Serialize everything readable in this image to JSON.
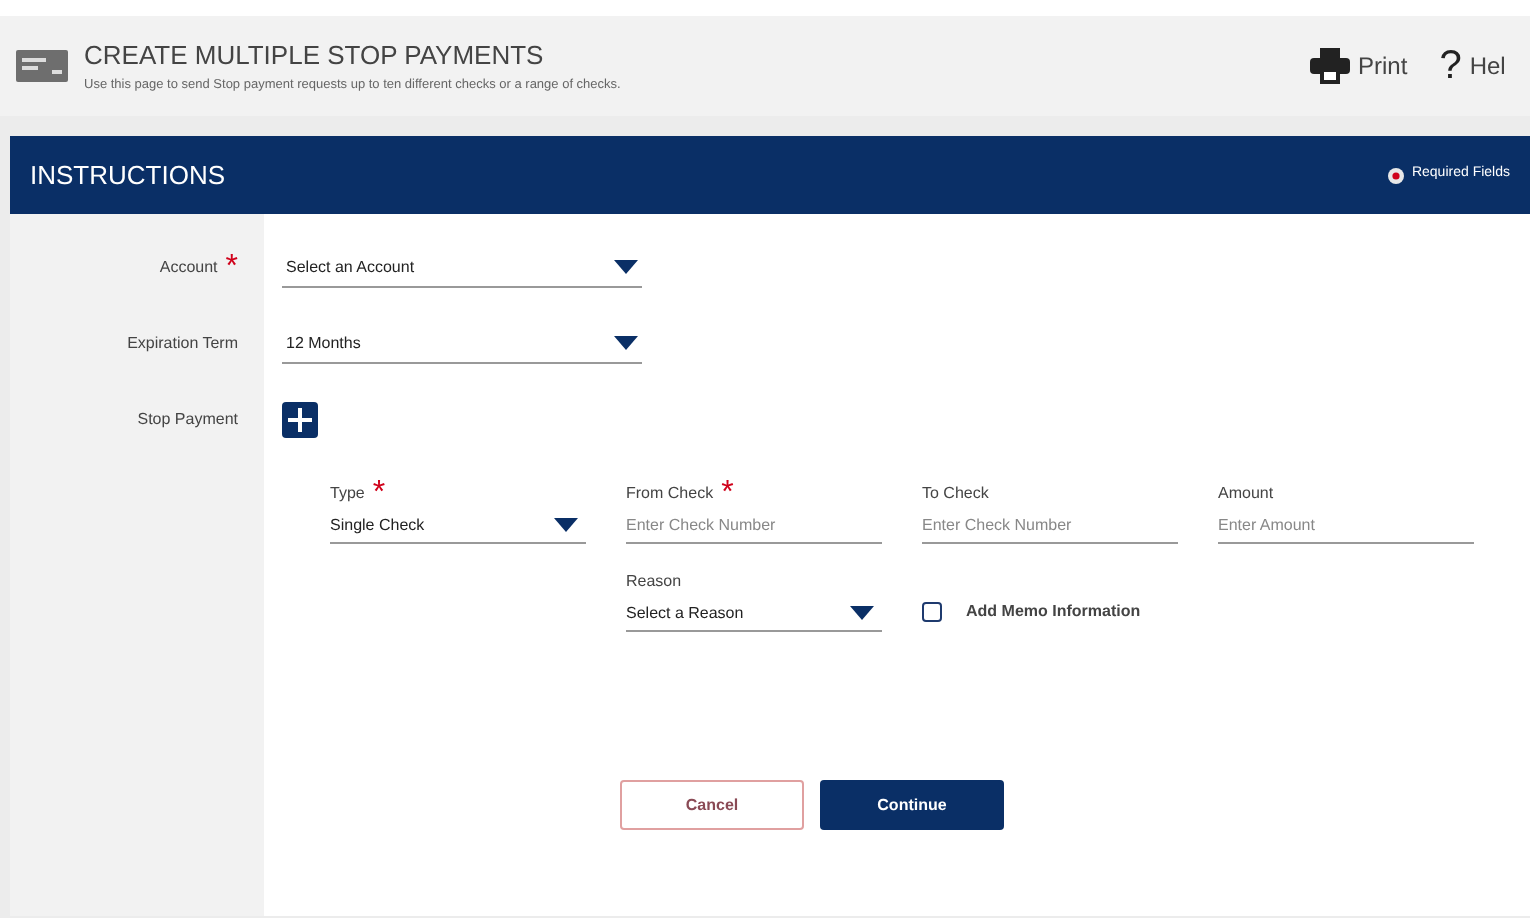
{
  "header": {
    "title": "CREATE MULTIPLE STOP PAYMENTS",
    "subtitle": "Use this page to send Stop payment requests up to ten different checks or a range of checks.",
    "actions": [
      {
        "kind": "print",
        "label": "Print"
      },
      {
        "kind": "help",
        "icon": "?",
        "label": "Hel"
      }
    ]
  },
  "section": {
    "title": "INSTRUCTIONS",
    "required_note": "Required Fields"
  },
  "form_rows": [
    {
      "kind": "select",
      "label": "Account",
      "required_mark": "*",
      "value": "Select an Account"
    },
    {
      "kind": "select",
      "label": "Expiration Term",
      "value": "12 Months"
    },
    {
      "kind": "add",
      "label": "Stop Payment"
    }
  ],
  "stop_payment_fields": [
    {
      "kind": "select",
      "label": "Type",
      "required_mark": "*",
      "value": "Single Check"
    },
    {
      "kind": "input",
      "label": "From Check",
      "required_mark": "*",
      "placeholder": "Enter Check Number"
    },
    {
      "kind": "input",
      "label": "To Check",
      "placeholder": "Enter Check Number"
    },
    {
      "kind": "input",
      "label": "Amount",
      "placeholder": "Enter Amount"
    },
    {
      "kind": "spacer"
    },
    {
      "kind": "select",
      "label": "Reason",
      "value": "Select a Reason"
    },
    {
      "kind": "checkbox",
      "label": "Add Memo Information",
      "checked": false
    }
  ],
  "buttons": [
    {
      "kind": "secondary",
      "label": "Cancel"
    },
    {
      "kind": "primary",
      "label": "Continue"
    }
  ]
}
